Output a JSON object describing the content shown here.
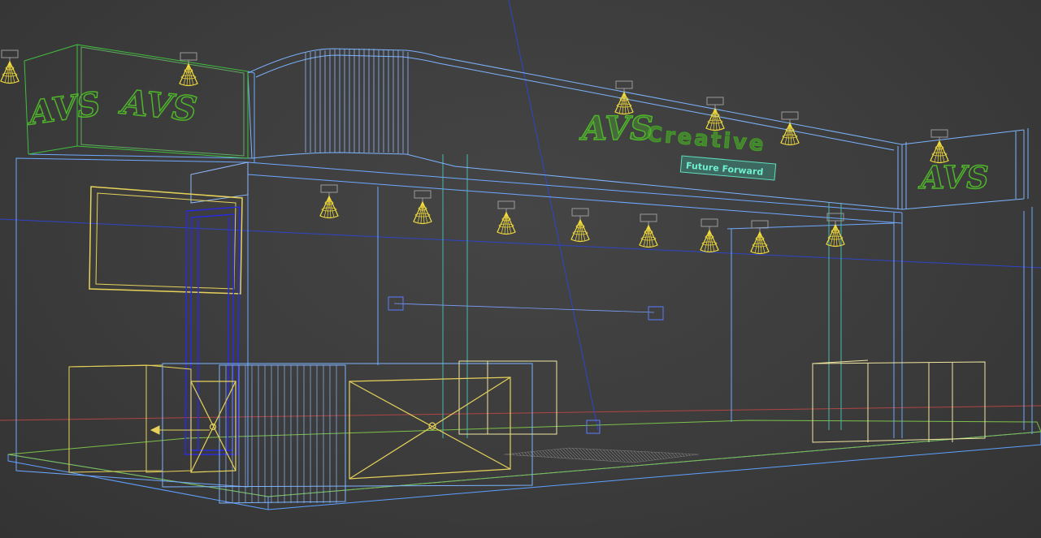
{
  "viewport": {
    "name": "3D wireframe perspective viewport",
    "background": "#3d3d3d",
    "render_mode": "wireframe"
  },
  "colors": {
    "booth_wire": "#6fa8ff",
    "booth_wire_light": "#8fb8ff",
    "green_wire": "#3fbf3f",
    "yellow_wire": "#e6d25a",
    "yellow_light": "#f2dc3c",
    "teal_wire": "#48b8b0",
    "blue_axis": "#3355dd",
    "dark_blue_door": "#2a2ae0",
    "red_axis": "#c04040",
    "spot_gray": "#9a9a9a",
    "logo_green": "#4fb52a",
    "slogan_teal": "#5fe0c0"
  },
  "signage": {
    "left_logo_1": "AVS",
    "left_logo_2": "AVS",
    "brand_logo": "AVS",
    "brand_name": "Creative",
    "slogan": "Future Forward",
    "right_logo": "AVS"
  },
  "icons": {
    "spotlight": "spotlight-icon",
    "light_target": "light-target-icon",
    "gizmo_arrow": "move-gizmo-icon"
  }
}
